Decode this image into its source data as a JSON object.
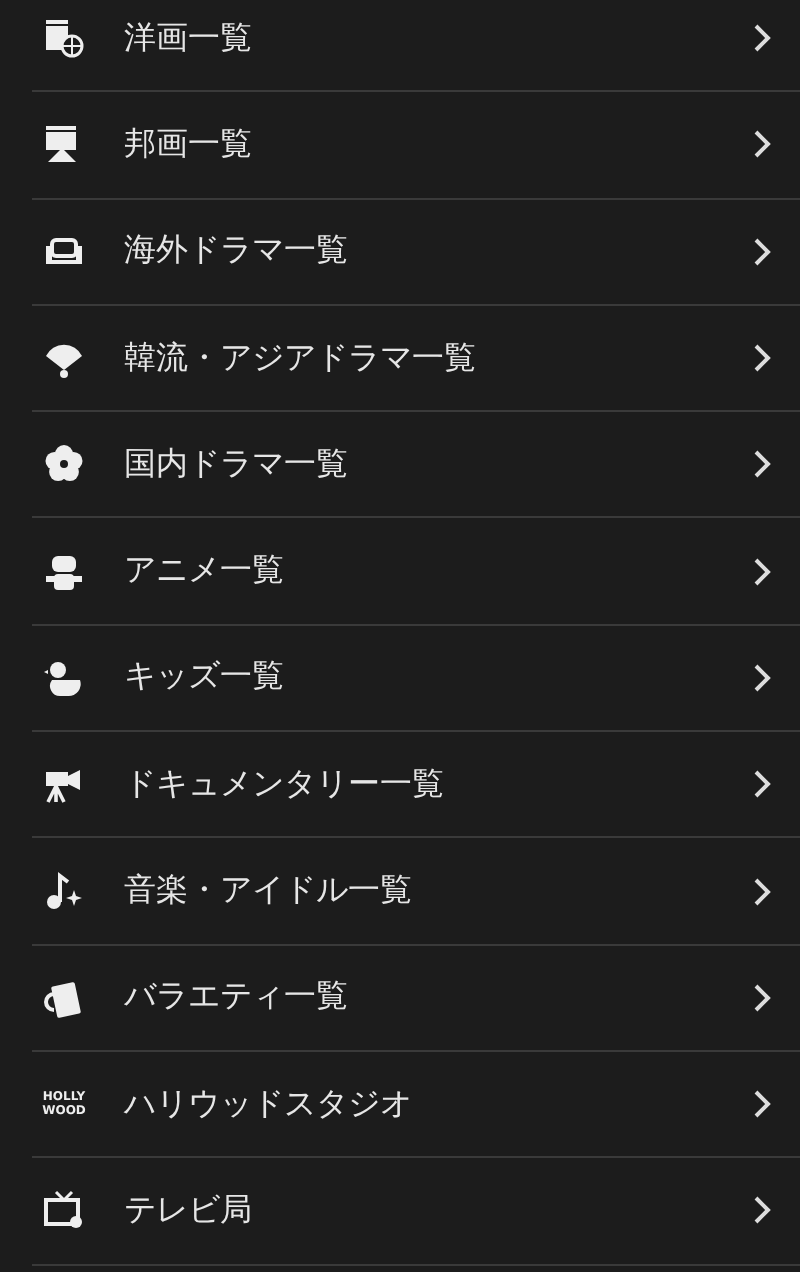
{
  "menu": [
    {
      "label": "洋画一覧"
    },
    {
      "label": "邦画一覧"
    },
    {
      "label": "海外ドラマ一覧"
    },
    {
      "label": "韓流・アジアドラマ一覧"
    },
    {
      "label": "国内ドラマ一覧"
    },
    {
      "label": "アニメ一覧"
    },
    {
      "label": "キッズ一覧"
    },
    {
      "label": "ドキュメンタリー一覧"
    },
    {
      "label": "音楽・アイドル一覧"
    },
    {
      "label": "バラエティ一覧"
    },
    {
      "label": "ハリウッドスタジオ",
      "icon_text": [
        "HOLLY",
        "WOOD"
      ]
    },
    {
      "label": "テレビ局"
    }
  ]
}
